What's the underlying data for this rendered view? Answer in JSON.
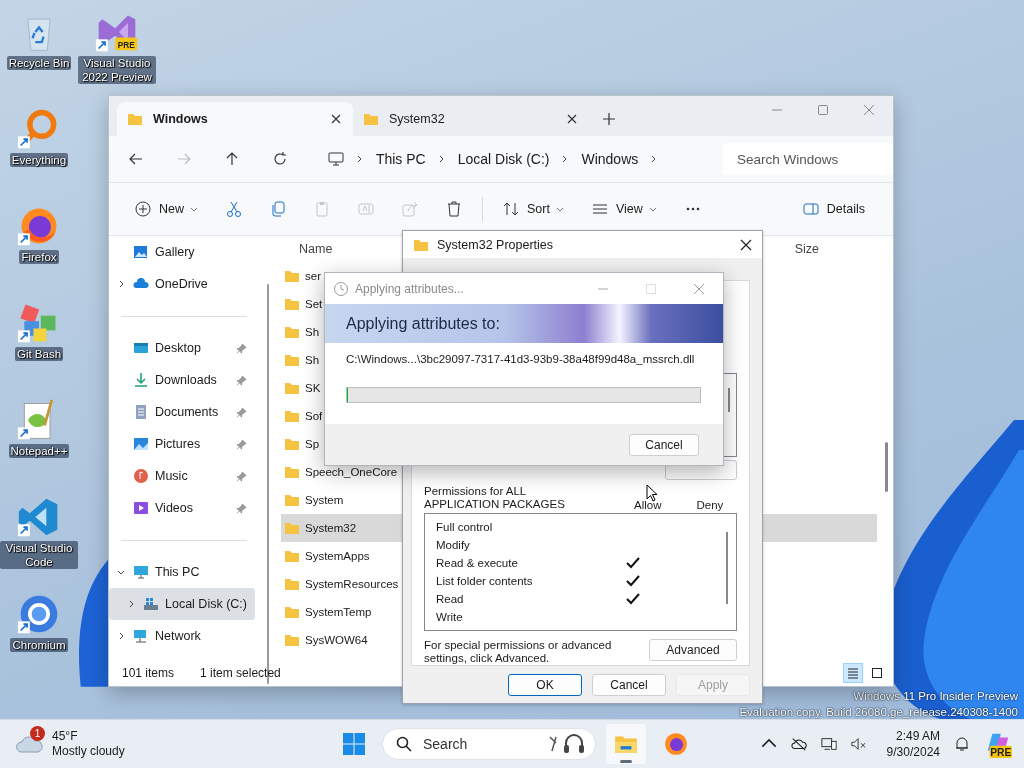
{
  "desktop_icons": [
    {
      "label": "Recycle Bin",
      "kind": "recycle",
      "shortcut": false
    },
    {
      "label": "Visual Studio 2022 Preview",
      "kind": "vs",
      "shortcut": true,
      "badge": "PRE"
    },
    {
      "label": "Everything",
      "kind": "everything",
      "shortcut": true
    },
    {
      "label": "Firefox",
      "kind": "firefox",
      "shortcut": true
    },
    {
      "label": "Git Bash",
      "kind": "git",
      "shortcut": true
    },
    {
      "label": "Notepad++",
      "kind": "notepad",
      "shortcut": true
    },
    {
      "label": "Visual Studio Code",
      "kind": "vscode",
      "shortcut": true
    },
    {
      "label": "Chromium",
      "kind": "chromium",
      "shortcut": true
    }
  ],
  "explorer": {
    "tabs": [
      {
        "title": "Windows",
        "selected": true
      },
      {
        "title": "System32",
        "selected": false
      }
    ],
    "breadcrumb": [
      "This PC",
      "Local Disk (C:)",
      "Windows"
    ],
    "search": {
      "placeholder": "Search Windows"
    },
    "toolbar": [
      {
        "kind": "new",
        "label": "New",
        "disabled": false
      },
      {
        "kind": "cut",
        "disabled": false
      },
      {
        "kind": "copy",
        "disabled": false
      },
      {
        "kind": "paste",
        "disabled": true
      },
      {
        "kind": "rename",
        "disabled": true
      },
      {
        "kind": "share",
        "disabled": true
      },
      {
        "kind": "delete",
        "disabled": false
      },
      {
        "kind": "sort",
        "label": "Sort",
        "disabled": false
      },
      {
        "kind": "view",
        "label": "View",
        "disabled": false
      },
      {
        "kind": "more",
        "disabled": false
      }
    ],
    "details_button": "Details",
    "sidebar": {
      "groups": [
        [
          {
            "label": "Gallery",
            "kind": "gallery",
            "selected": false
          },
          {
            "label": "OneDrive",
            "kind": "cloud",
            "selected": false,
            "expanded": false
          }
        ],
        [
          {
            "label": "Desktop",
            "kind": "desktop",
            "selected": false,
            "pinned": true
          },
          {
            "label": "Downloads",
            "kind": "download",
            "selected": false,
            "pinned": true
          },
          {
            "label": "Documents",
            "kind": "document",
            "selected": false,
            "pinned": true
          },
          {
            "label": "Pictures",
            "kind": "pictures",
            "selected": false,
            "pinned": true
          },
          {
            "label": "Music",
            "kind": "music",
            "selected": false,
            "pinned": true
          },
          {
            "label": "Videos",
            "kind": "video",
            "selected": false,
            "pinned": true
          }
        ],
        [
          {
            "label": "This PC",
            "kind": "pc",
            "selected": false,
            "expanded": true,
            "children": [
              {
                "label": "Local Disk (C:)",
                "kind": "disk",
                "selected": true,
                "expanded": false
              }
            ]
          },
          {
            "label": "Network",
            "kind": "network",
            "selected": false,
            "expanded": false
          }
        ]
      ]
    },
    "columns": [
      "Name",
      "Size"
    ],
    "files": [
      {
        "name": "ser",
        "selected": false
      },
      {
        "name": "Set",
        "selected": false
      },
      {
        "name": "Sh",
        "selected": false
      },
      {
        "name": "Sh",
        "selected": false
      },
      {
        "name": "SK",
        "selected": false
      },
      {
        "name": "Sof",
        "selected": false
      },
      {
        "name": "Sp",
        "selected": false
      },
      {
        "name": "Speech_OneCore",
        "selected": false
      },
      {
        "name": "System",
        "selected": false
      },
      {
        "name": "System32",
        "selected": true
      },
      {
        "name": "SystemApps",
        "selected": false
      },
      {
        "name": "SystemResources",
        "selected": false
      },
      {
        "name": "SystemTemp",
        "selected": false
      },
      {
        "name": "SysWOW64",
        "selected": false
      }
    ],
    "status": {
      "count": "101 items",
      "selection": "1 item selected"
    },
    "views": [
      {
        "kind": "details",
        "selected": true
      },
      {
        "kind": "tiles",
        "selected": false
      }
    ]
  },
  "properties": {
    "title": "System32 Properties",
    "permissions_label": "Permissions for ALL APPLICATION PACKAGES",
    "allow": "Allow",
    "deny": "Deny",
    "permissions": [
      {
        "name": "Full control",
        "allow": false,
        "deny": false
      },
      {
        "name": "Modify",
        "allow": false,
        "deny": false
      },
      {
        "name": "Read & execute",
        "allow": true,
        "deny": false
      },
      {
        "name": "List folder contents",
        "allow": true,
        "deny": false
      },
      {
        "name": "Read",
        "allow": true,
        "deny": false
      },
      {
        "name": "Write",
        "allow": false,
        "deny": false
      }
    ],
    "advanced_note": "For special permissions or advanced settings, click Advanced.",
    "advanced_button": "Advanced",
    "buttons": [
      {
        "label": "OK",
        "kind": "default",
        "disabled": false
      },
      {
        "label": "Cancel",
        "kind": "normal",
        "disabled": false
      },
      {
        "label": "Apply",
        "kind": "normal",
        "disabled": true
      }
    ]
  },
  "applying": {
    "title": "Applying attributes...",
    "heading": "Applying attributes to:",
    "path": "C:\\Windows...\\3bc29097-7317-41d3-93b9-38a48f99d48a_mssrch.dll",
    "level": 0,
    "cancel": "Cancel"
  },
  "watermark": [
    "Windows 11 Pro Insider Preview",
    "Evaluation copy. Build 26080.ge_release.240308-1400"
  ],
  "taskbar": {
    "weather": {
      "badge": "1",
      "temp": "45°F",
      "condition": "Mostly cloudy"
    },
    "search": {
      "placeholder": "Search"
    },
    "apps": [
      {
        "kind": "explorer",
        "active": true
      },
      {
        "kind": "firefox",
        "active": false
      }
    ],
    "clock": {
      "time": "2:49 AM",
      "date": "9/30/2024"
    },
    "copilot_badge": "PRE"
  }
}
